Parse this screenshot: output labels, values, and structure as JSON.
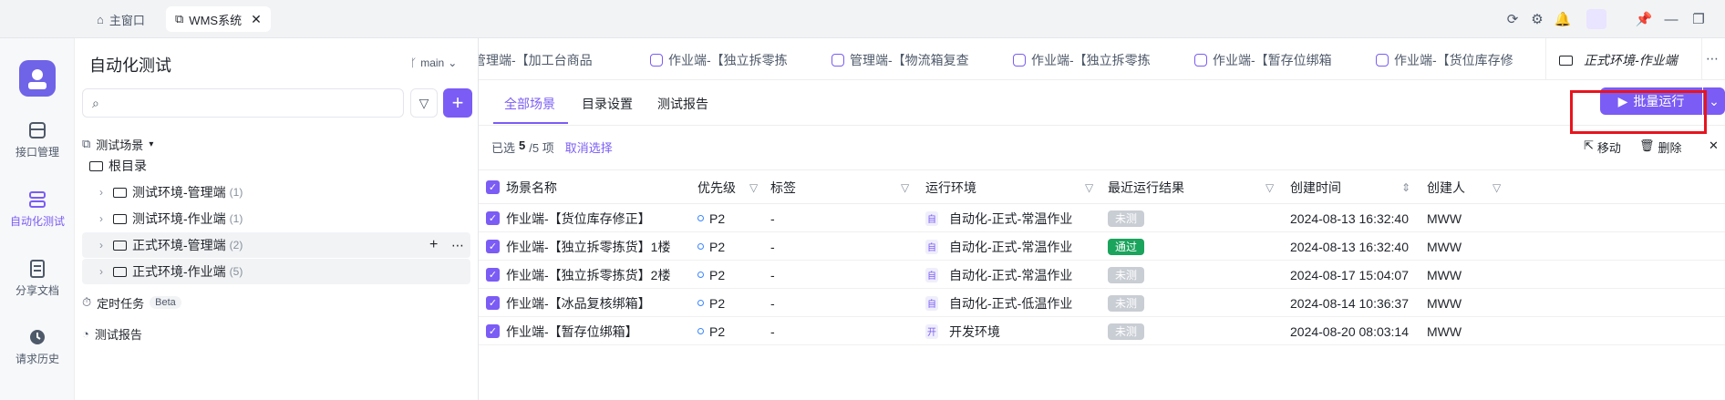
{
  "titlebar": {
    "tabs": [
      {
        "label": "主窗口",
        "icon": "home-icon"
      },
      {
        "label": "WMS系统",
        "icon": "link-icon",
        "close": "✕"
      }
    ]
  },
  "leftnav": {
    "items": [
      {
        "label": "接口管理"
      },
      {
        "label": "自动化测试"
      },
      {
        "label": "分享文档"
      },
      {
        "label": "请求历史"
      }
    ]
  },
  "tree": {
    "title": "自动化测试",
    "branch": "main",
    "search_placeholder": "",
    "section_label": "测试场景",
    "root": "根目录",
    "folders": [
      {
        "label": "测试环境-管理端",
        "count": "(1)"
      },
      {
        "label": "测试环境-作业端",
        "count": "(1)"
      },
      {
        "label": "正式环境-管理端",
        "count": "(2)"
      },
      {
        "label": "正式环境-作业端",
        "count": "(5)"
      }
    ],
    "scheduled": "定时任务",
    "beta": "Beta",
    "report": "测试报告"
  },
  "page_tabs": [
    "管理端-【加工台商品",
    "作业端-【独立拆零拣",
    "管理端-【物流箱复查",
    "作业端-【独立拆零拣",
    "作业端-【暂存位绑箱",
    "作业端-【货位库存修",
    "正式环境-作业端"
  ],
  "subtabs": [
    "全部场景",
    "目录设置",
    "测试报告"
  ],
  "batch_run": "批量运行",
  "selection": {
    "prefix": "已选",
    "count": "5",
    "total": "/5 项",
    "cancel": "取消选择"
  },
  "actions": {
    "move": "移动",
    "delete": "删除"
  },
  "columns": [
    "场景名称",
    "优先级",
    "标签",
    "运行环境",
    "最近运行结果",
    "创建时间",
    "创建人"
  ],
  "rows": [
    {
      "name": "作业端-【货位库存修正】",
      "priority": "P2",
      "tag": "-",
      "env_icon": "自",
      "env": "自动化-正式-常温作业",
      "result": "未测",
      "result_color": "#c9cdd4",
      "created": "2024-08-13 16:32:40",
      "creator": "MWW"
    },
    {
      "name": "作业端-【独立拆零拣货】1楼",
      "priority": "P2",
      "tag": "-",
      "env_icon": "自",
      "env": "自动化-正式-常温作业",
      "result": "通过",
      "result_color": "#1aa45c",
      "created": "2024-08-13 16:32:40",
      "creator": "MWW"
    },
    {
      "name": "作业端-【独立拆零拣货】2楼",
      "priority": "P2",
      "tag": "-",
      "env_icon": "自",
      "env": "自动化-正式-常温作业",
      "result": "未测",
      "result_color": "#c9cdd4",
      "created": "2024-08-17 15:04:07",
      "creator": "MWW"
    },
    {
      "name": "作业端-【冰品复核绑箱】",
      "priority": "P2",
      "tag": "-",
      "env_icon": "自",
      "env": "自动化-正式-低温作业",
      "result": "未测",
      "result_color": "#c9cdd4",
      "created": "2024-08-14 10:36:37",
      "creator": "MWW"
    },
    {
      "name": "作业端-【暂存位绑箱】",
      "priority": "P2",
      "tag": "-",
      "env_icon": "开",
      "env": "开发环境",
      "result": "未测",
      "result_color": "#c9cdd4",
      "created": "2024-08-20 08:03:14",
      "creator": "MWW"
    }
  ],
  "colors": {
    "accent": "#7b5cf5",
    "highlight_box": "#e8141e"
  }
}
